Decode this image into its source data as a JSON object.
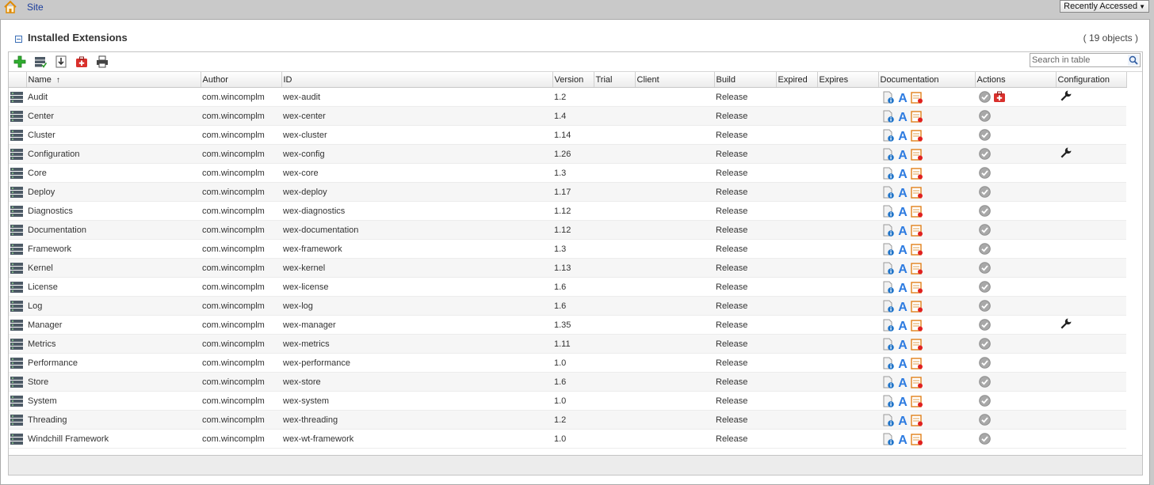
{
  "topbar": {
    "site_label": "Site",
    "recent_label": "Recently Accessed"
  },
  "panel": {
    "title": "Installed Extensions",
    "count": "( 19 objects )"
  },
  "toolbar": {
    "search_placeholder": "Search in table"
  },
  "columns": [
    "Name",
    "Author",
    "ID",
    "Version",
    "Trial",
    "Client",
    "Build",
    "Expired",
    "Expires",
    "Documentation",
    "Actions",
    "Configuration"
  ],
  "rows": [
    {
      "name": "Audit",
      "author": "com.wincomplm",
      "id": "wex-audit",
      "version": "1.2",
      "build": "Release",
      "repair": true,
      "config": true
    },
    {
      "name": "Center",
      "author": "com.wincomplm",
      "id": "wex-center",
      "version": "1.4",
      "build": "Release",
      "repair": false,
      "config": false
    },
    {
      "name": "Cluster",
      "author": "com.wincomplm",
      "id": "wex-cluster",
      "version": "1.14",
      "build": "Release",
      "repair": false,
      "config": false
    },
    {
      "name": "Configuration",
      "author": "com.wincomplm",
      "id": "wex-config",
      "version": "1.26",
      "build": "Release",
      "repair": false,
      "config": true
    },
    {
      "name": "Core",
      "author": "com.wincomplm",
      "id": "wex-core",
      "version": "1.3",
      "build": "Release",
      "repair": false,
      "config": false
    },
    {
      "name": "Deploy",
      "author": "com.wincomplm",
      "id": "wex-deploy",
      "version": "1.17",
      "build": "Release",
      "repair": false,
      "config": false
    },
    {
      "name": "Diagnostics",
      "author": "com.wincomplm",
      "id": "wex-diagnostics",
      "version": "1.12",
      "build": "Release",
      "repair": false,
      "config": false
    },
    {
      "name": "Documentation",
      "author": "com.wincomplm",
      "id": "wex-documentation",
      "version": "1.12",
      "build": "Release",
      "repair": false,
      "config": false
    },
    {
      "name": "Framework",
      "author": "com.wincomplm",
      "id": "wex-framework",
      "version": "1.3",
      "build": "Release",
      "repair": false,
      "config": false
    },
    {
      "name": "Kernel",
      "author": "com.wincomplm",
      "id": "wex-kernel",
      "version": "1.13",
      "build": "Release",
      "repair": false,
      "config": false
    },
    {
      "name": "License",
      "author": "com.wincomplm",
      "id": "wex-license",
      "version": "1.6",
      "build": "Release",
      "repair": false,
      "config": false
    },
    {
      "name": "Log",
      "author": "com.wincomplm",
      "id": "wex-log",
      "version": "1.6",
      "build": "Release",
      "repair": false,
      "config": false
    },
    {
      "name": "Manager",
      "author": "com.wincomplm",
      "id": "wex-manager",
      "version": "1.35",
      "build": "Release",
      "repair": false,
      "config": true
    },
    {
      "name": "Metrics",
      "author": "com.wincomplm",
      "id": "wex-metrics",
      "version": "1.11",
      "build": "Release",
      "repair": false,
      "config": false
    },
    {
      "name": "Performance",
      "author": "com.wincomplm",
      "id": "wex-performance",
      "version": "1.0",
      "build": "Release",
      "repair": false,
      "config": false
    },
    {
      "name": "Store",
      "author": "com.wincomplm",
      "id": "wex-store",
      "version": "1.6",
      "build": "Release",
      "repair": false,
      "config": false
    },
    {
      "name": "System",
      "author": "com.wincomplm",
      "id": "wex-system",
      "version": "1.0",
      "build": "Release",
      "repair": false,
      "config": false
    },
    {
      "name": "Threading",
      "author": "com.wincomplm",
      "id": "wex-threading",
      "version": "1.2",
      "build": "Release",
      "repair": false,
      "config": false
    },
    {
      "name": "Windchill Framework",
      "author": "com.wincomplm",
      "id": "wex-wt-framework",
      "version": "1.0",
      "build": "Release",
      "repair": false,
      "config": false
    }
  ]
}
